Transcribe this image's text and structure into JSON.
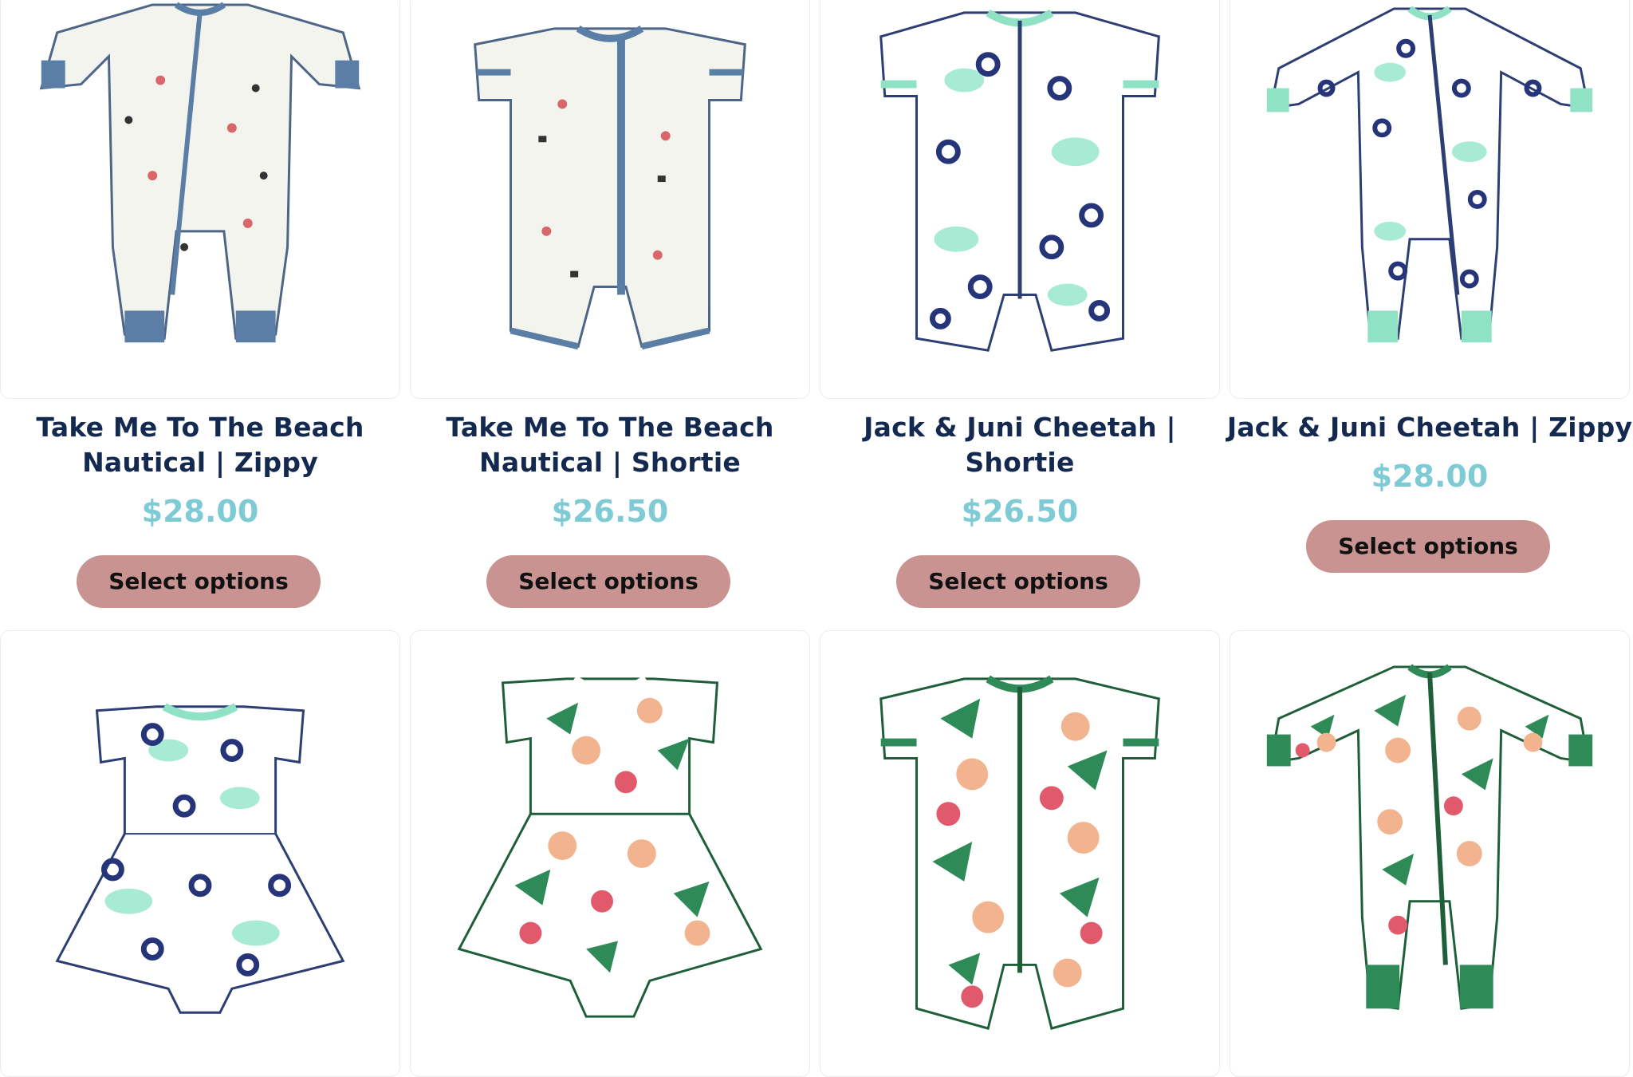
{
  "products_row1": [
    {
      "title_line1": "Take Me To The Beach",
      "title_line2": "Nautical | Zippy",
      "price": "$28.00",
      "button": "Select options",
      "illustration": "nautical-zippy-romper",
      "trim_color": "#5b7ea6"
    },
    {
      "title_line1": "Take Me To The Beach",
      "title_line2": "Nautical | Shortie",
      "price": "$26.50",
      "button": "Select options",
      "illustration": "nautical-shortie-romper",
      "trim_color": "#5b7ea6"
    },
    {
      "title_line1": "Jack & Juni Cheetah |",
      "title_line2": "Shortie",
      "price": "$26.50",
      "button": "Select options",
      "illustration": "cheetah-shortie-romper",
      "trim_color": "#8fe3c4"
    },
    {
      "title_line1": "Jack & Juni Cheetah | Zippy",
      "title_line2": "",
      "price": "$28.00",
      "button": "Select options",
      "illustration": "cheetah-zippy-romper",
      "trim_color": "#8fe3c4"
    }
  ],
  "products_row2": [
    {
      "illustration": "cheetah-twirl-bodysuit-dress",
      "trim_color": "#8fe3c4"
    },
    {
      "illustration": "tropical-floral-twirl-bodysuit-dress",
      "trim_color": "#2e8b57"
    },
    {
      "illustration": "tropical-floral-shortie-romper",
      "trim_color": "#2e8b57"
    },
    {
      "illustration": "tropical-floral-zippy-romper",
      "trim_color": "#2e8b57"
    }
  ],
  "colors": {
    "title": "#14294f",
    "price": "#7ecbd6",
    "button_bg": "#c99392",
    "button_text": "#111111"
  }
}
